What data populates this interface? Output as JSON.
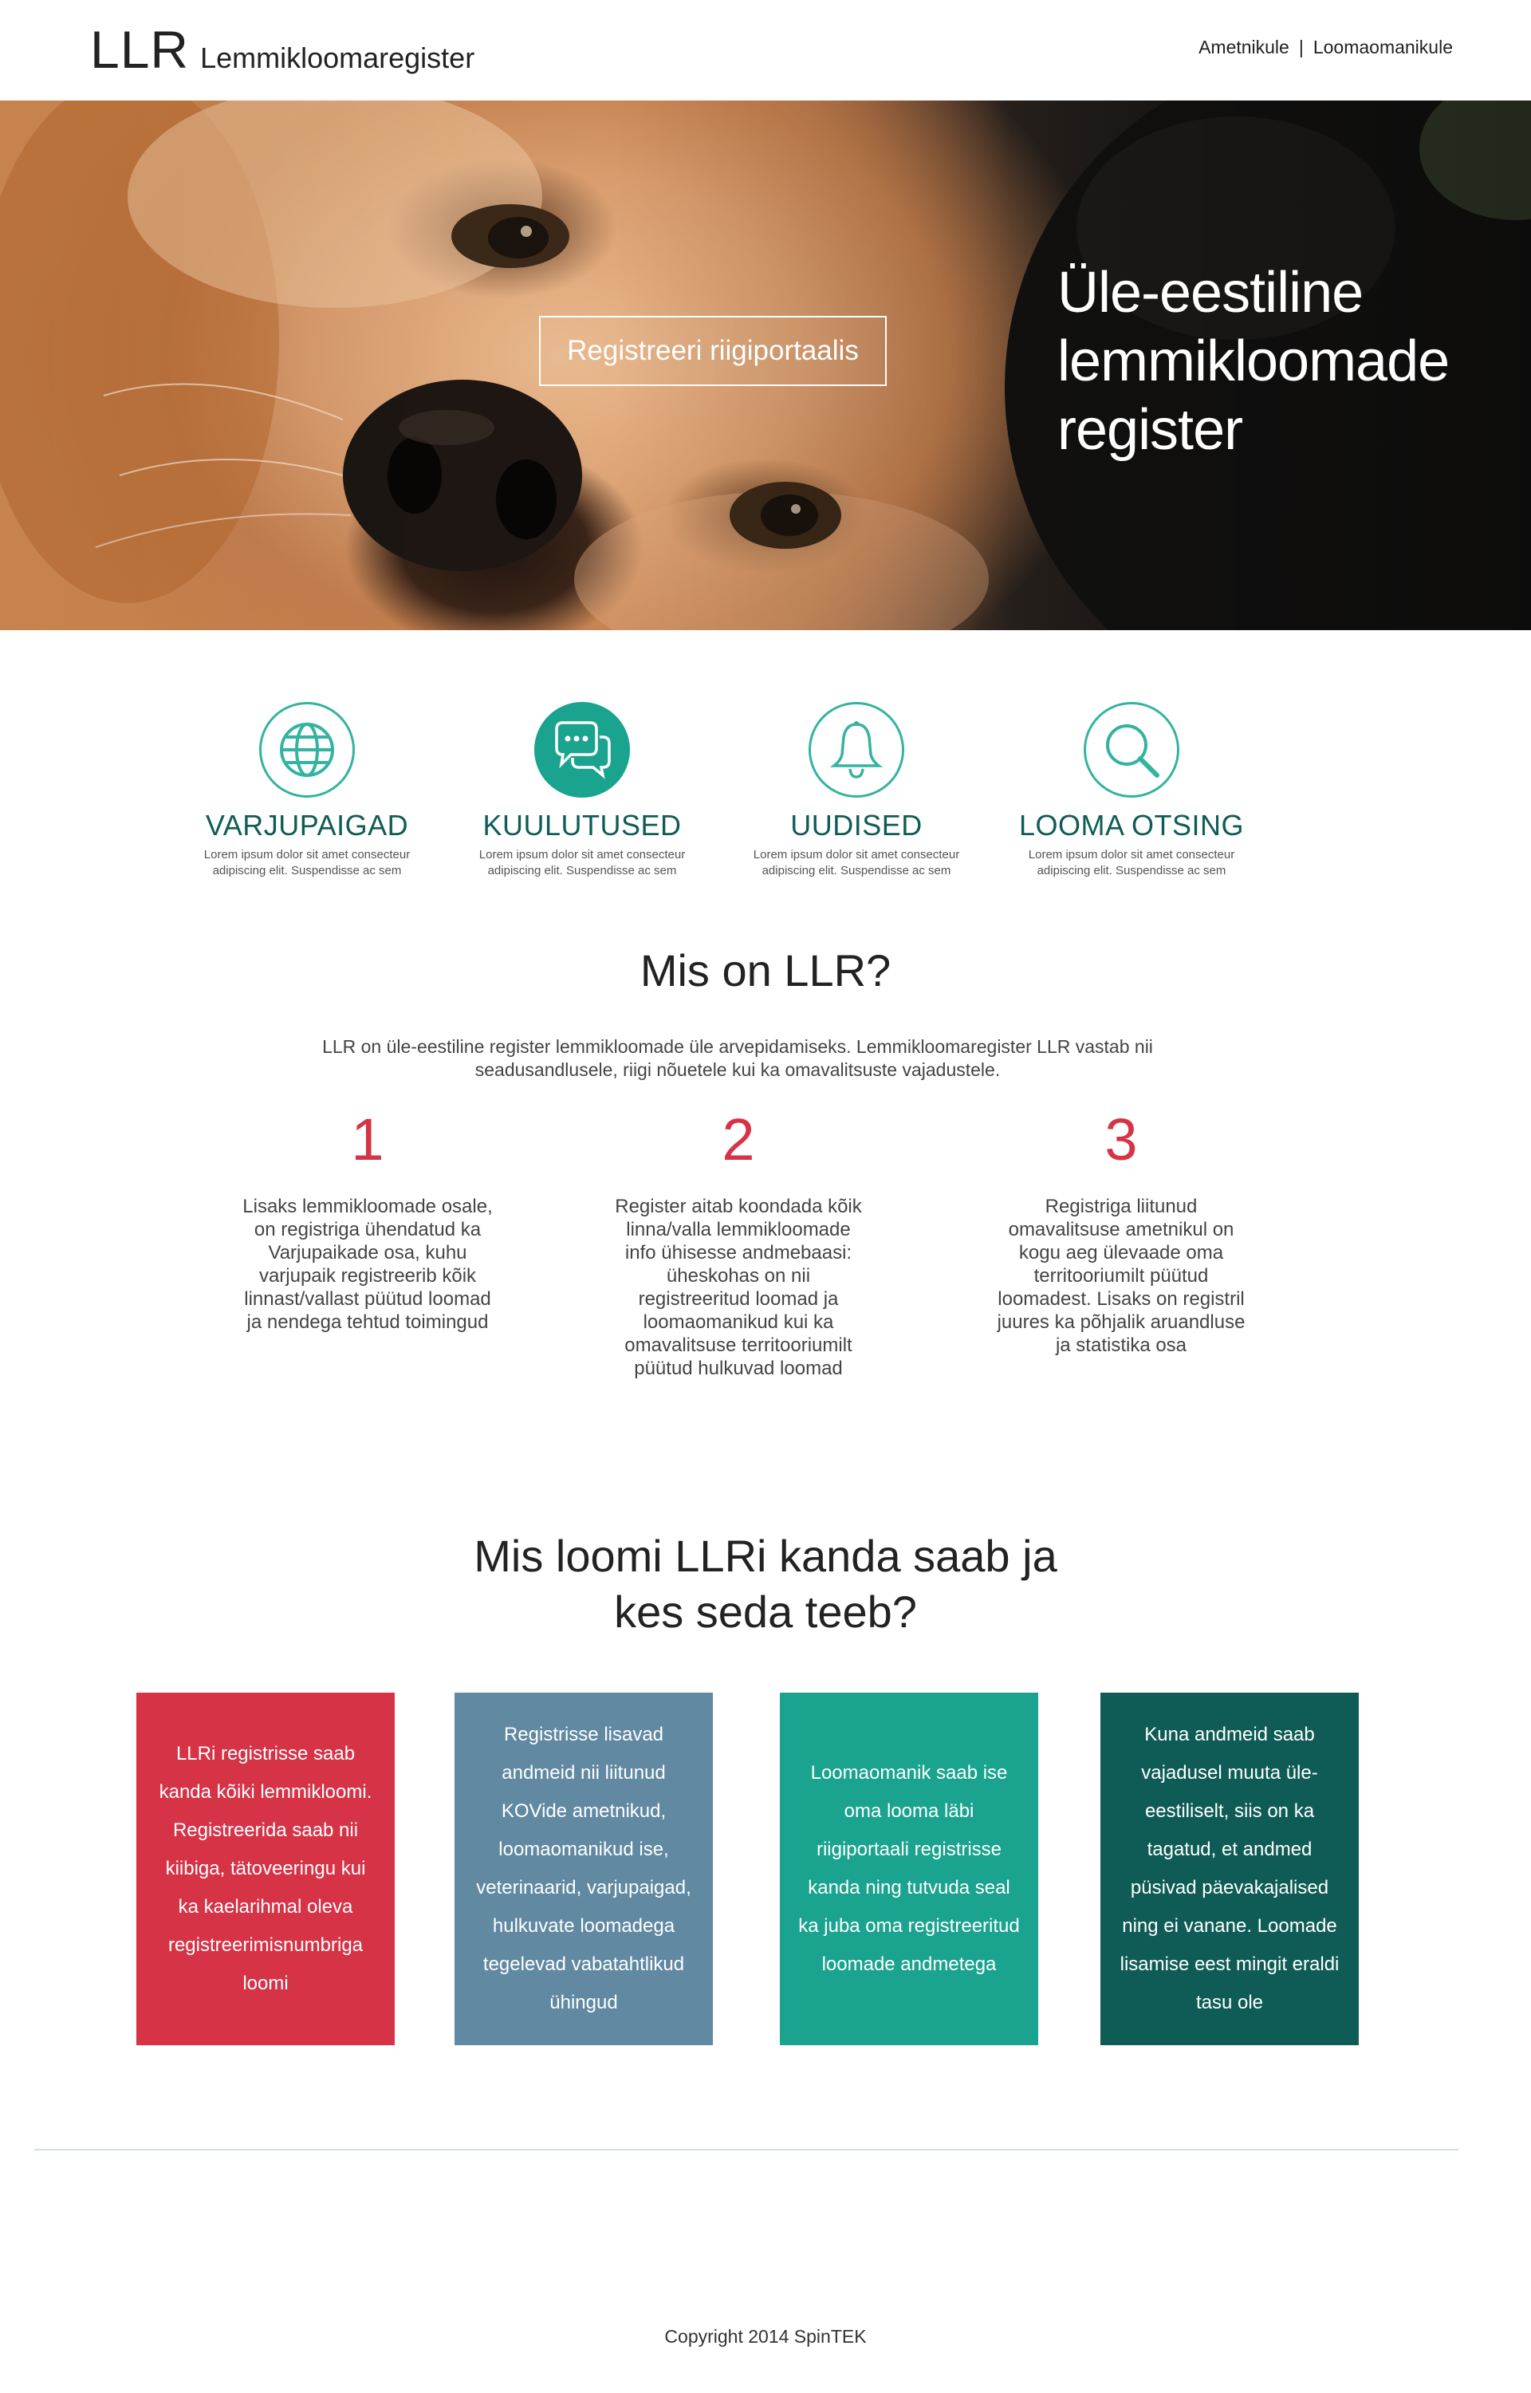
{
  "header": {
    "logo_mark": "LLR",
    "logo_text": "Lemmikloomaregister",
    "nav": [
      "Ametnikule",
      "Loomaomanikule"
    ],
    "nav_separator": "|"
  },
  "hero": {
    "button_label": "Registreeri riigiportaalis",
    "title": "Üle-eestiline lemmikloomade register"
  },
  "features": [
    {
      "icon": "globe-icon",
      "title": "VARJUPAIGAD",
      "text": "Lorem ipsum dolor sit amet consecteur adipiscing elit. Suspendisse ac sem"
    },
    {
      "icon": "chat-bubbles-icon",
      "title": "KUULUTUSED",
      "text": "Lorem ipsum dolor sit amet consecteur adipiscing elit. Suspendisse ac sem"
    },
    {
      "icon": "bell-icon",
      "title": "UUDISED",
      "text": "Lorem ipsum dolor sit amet consecteur adipiscing elit. Suspendisse ac sem"
    },
    {
      "icon": "search-icon",
      "title": "LOOMA OTSING",
      "text": "Lorem ipsum dolor sit amet consecteur adipiscing elit. Suspendisse ac sem"
    }
  ],
  "about": {
    "title": "Mis on LLR?",
    "intro": "LLR on üle-eestiline register lemmikloomade üle arvepidamiseks. Lemmikloomaregister LLR vastab nii seadusandlusele, riigi nõuetele kui ka omavalitsuste vajadustele.",
    "columns": [
      {
        "num": "1",
        "text": "Lisaks lemmikloomade osale, on registriga ühendatud ka Varjupaikade osa, kuhu varjupaik registreerib kõik linnast/vallast püütud loomad ja nendega tehtud toimingud"
      },
      {
        "num": "2",
        "text": "Register aitab koondada kõik linna/valla lemmikloomade info ühisesse andmebaasi: üheskohas on nii registreeritud loomad ja loomaomanikud kui ka omavalitsuse territooriumilt püütud hulkuvad loomad"
      },
      {
        "num": "3",
        "text": "Registriga liitunud omavalitsuse ametnikul on kogu aeg ülevaade oma territooriumilt püütud loomadest. Lisaks on registril juures ka põhjalik aruandluse ja statistika osa"
      }
    ]
  },
  "who": {
    "title_line1": "Mis loomi LLRi kanda saab ja",
    "title_line2": "kes seda teeb?",
    "boxes": [
      {
        "color": "#d63346",
        "text": "LLRi registrisse saab kanda kõiki lemmikloomi. Registreerida saab nii kiibiga, tätoveeringu kui ka kaelarihmal oleva registreerimisnumbriga loomi"
      },
      {
        "color": "#6189a2",
        "text": "Registrisse lisavad andmeid nii liitunud KOVide ametnikud, loomaomanikud ise, veterinaarid, varjupaigad, hulkuvate loomadega tegelevad vabatahtlikud ühingud"
      },
      {
        "color": "#1aa38e",
        "text": "Loomaomanik saab ise oma looma läbi riigiportaali registrisse kanda ning tutvuda seal ka juba oma registreeritud loomade andmetega"
      },
      {
        "color": "#0f5c56",
        "text": "Kuna andmeid saab vajadusel muuta üle-eestiliselt, siis on ka tagatud, et andmed püsivad päevakajalised ning ei vanane. Loomade lisamise eest mingit eraldi tasu ole"
      }
    ]
  },
  "footer": {
    "copyright": "Copyright 2014 SpinTEK"
  }
}
